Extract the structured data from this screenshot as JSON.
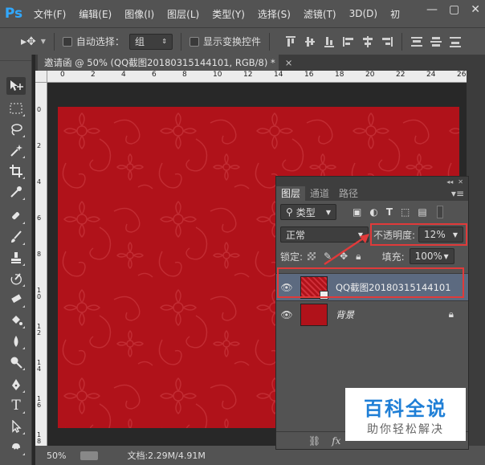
{
  "app": {
    "logo": "Ps"
  },
  "menu": [
    "文件(F)",
    "编辑(E)",
    "图像(I)",
    "图层(L)",
    "类型(Y)",
    "选择(S)",
    "滤镜(T)",
    "3D(D)",
    "初"
  ],
  "window_buttons": [
    "—",
    "▢",
    "✕"
  ],
  "options": {
    "auto_select_label": "自动选择：",
    "auto_select_value": "组",
    "show_transform_label": "显示变换控件"
  },
  "document": {
    "tab_title": "邀请函 @ 50% (QQ截图20180315144101, RGB/8) *",
    "close": "×"
  },
  "ruler": {
    "h_ticks": [
      "0",
      "2",
      "4",
      "6",
      "8",
      "10",
      "12",
      "14",
      "16",
      "18",
      "20",
      "22",
      "24",
      "26"
    ],
    "v_ticks": [
      "0",
      "2",
      "4",
      "6",
      "8",
      "10",
      "12",
      "14",
      "16",
      "18"
    ]
  },
  "status": {
    "zoom": "50%",
    "doc_info": "文档:2.29M/4.91M"
  },
  "layers_panel": {
    "tabs": [
      "图层",
      "通道",
      "路径"
    ],
    "filter_label": "类型",
    "blend_mode": "正常",
    "opacity_label": "不透明度:",
    "opacity_value": "12%",
    "lock_label": "锁定:",
    "fill_label": "填充:",
    "fill_value": "100%",
    "layers": [
      {
        "name": "QQ截图20180315144101",
        "selected": true
      },
      {
        "name": "背景",
        "selected": false
      }
    ],
    "footer_fx": "fx"
  },
  "watermark": {
    "line1": "百科全说",
    "line2": "助你轻松解决"
  },
  "colors": {
    "canvas_red": "#b0121a",
    "highlight": "#e03a3a",
    "panel_bg": "#535353"
  }
}
